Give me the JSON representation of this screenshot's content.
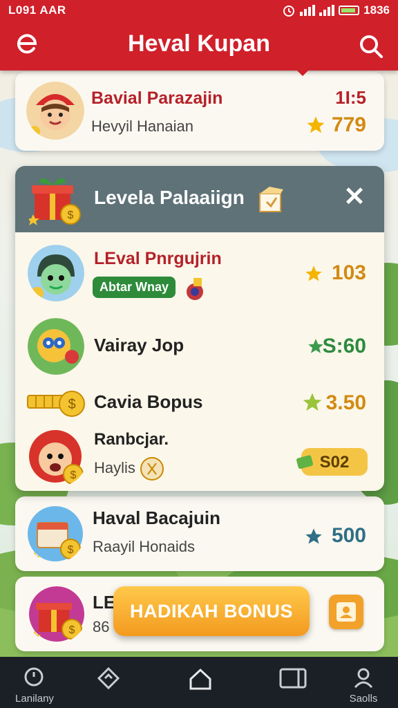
{
  "status_bar": {
    "time": "L091 AAR",
    "clock": "1836"
  },
  "app_bar": {
    "title": "Heval Kupan"
  },
  "top_card": {
    "name": "Bavial Parazajin",
    "subtitle": "Hevyil Hanaian",
    "count": "1I:5",
    "value": "779"
  },
  "modal": {
    "title": "Levela Palaaiign",
    "rows": [
      {
        "name": "LEval Pnrgujrin",
        "badge": "Abtar Wnay",
        "value": "103"
      },
      {
        "name": "Vairay Jop",
        "value": "S:60"
      },
      {
        "name": "Cavia Bopus",
        "value": "3.50"
      },
      {
        "name": "Ranbcjar.",
        "subtitle": "Haylis",
        "value": "S02"
      }
    ]
  },
  "card_2": {
    "name": "Haval Bacajuin",
    "subtitle": "Raayil Honaids",
    "value": "500"
  },
  "card_3": {
    "name": "LE",
    "subtitle": "86"
  },
  "cta": {
    "label": "HADIKAH BONUS"
  },
  "bottom_nav": {
    "items": [
      {
        "label": "Lanilany",
        "icon": "clock-icon"
      },
      {
        "label": "",
        "icon": "diamond-icon"
      },
      {
        "label": "",
        "icon": "home-icon"
      },
      {
        "label": "",
        "icon": "tablet-icon"
      },
      {
        "label": "Saolls",
        "icon": "profile-icon"
      }
    ]
  },
  "colors": {
    "primary": "#d0202a",
    "modal_header": "#5e7278",
    "cta": "#f39a1f",
    "nav": "#1b1f26"
  }
}
